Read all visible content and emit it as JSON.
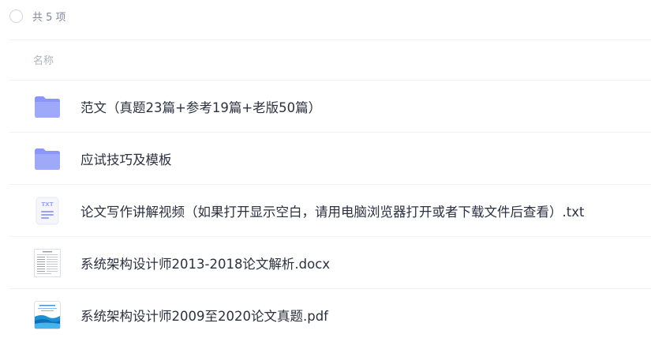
{
  "summary": {
    "text": "共 5 项"
  },
  "columns": {
    "name": "名称"
  },
  "files": [
    {
      "name": "范文（真题23篇+参考19篇+老版50篇）",
      "icon": "folder-icon"
    },
    {
      "name": "应试技巧及模板",
      "icon": "folder-icon"
    },
    {
      "name": "论文写作讲解视频（如果打开显示空白，请用电脑浏览器打开或者下载文件后查看）.txt",
      "icon": "txt-file-icon",
      "badge": "TXT"
    },
    {
      "name": "系统架构设计师2013-2018论文解析.docx",
      "icon": "docx-thumbnail-icon"
    },
    {
      "name": "系统架构设计师2009至2020论文真题.pdf",
      "icon": "pdf-thumbnail-icon"
    }
  ],
  "colors": {
    "folder": "#8a97f8",
    "txt_badge": "#9aa3f5",
    "text_primary": "#2b3140",
    "text_secondary": "#818999"
  }
}
